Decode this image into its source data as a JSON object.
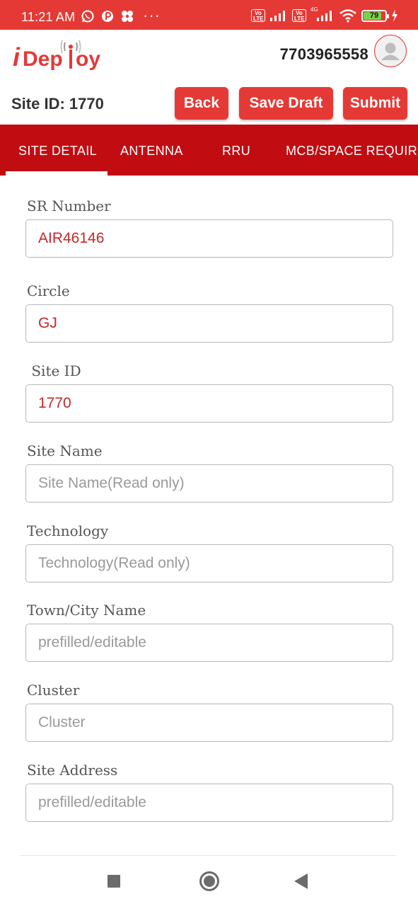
{
  "status_bar": {
    "time": "11:21 AM",
    "left_icons": [
      "whatsapp-icon",
      "pocket-icon",
      "fan-icon"
    ],
    "overflow": "···",
    "volte_1": "Vo LTE",
    "volte_2": "Vo LTE",
    "network_4g": "4G",
    "battery_level": "79",
    "colors": {
      "background": "#e53935"
    }
  },
  "header": {
    "logo_text": "iDeploy",
    "phone": "7703965558"
  },
  "actions": {
    "site_id_label": "Site ID: 1770",
    "back": "Back",
    "save_draft": "Save Draft",
    "submit": "Submit"
  },
  "tabs": [
    {
      "label": "SITE DETAIL",
      "active": true
    },
    {
      "label": "ANTENNA",
      "active": false
    },
    {
      "label": "RRU",
      "active": false
    },
    {
      "label": "MCB/SPACE REQUIR",
      "active": false
    }
  ],
  "form": {
    "sr_number": {
      "label": "SR Number",
      "value": "AIR46146"
    },
    "circle": {
      "label": "Circle",
      "value": "GJ"
    },
    "site_id": {
      "label": " Site ID",
      "value": "1770"
    },
    "site_name": {
      "label": "Site Name",
      "placeholder": "Site Name(Read only)"
    },
    "technology": {
      "label": "Technology",
      "placeholder": "Technology(Read only)"
    },
    "town_city": {
      "label": "Town/City Name",
      "placeholder": "prefilled/editable"
    },
    "cluster": {
      "label": "Cluster",
      "placeholder": "Cluster"
    },
    "site_address": {
      "label": "Site Address",
      "placeholder": "prefilled/editable"
    }
  },
  "nav": {
    "icons": [
      "recents-icon",
      "home-icon",
      "back-icon"
    ]
  },
  "theme": {
    "primary": "#e53935",
    "tab_bar": "#c10d12",
    "value_text": "#c62828"
  }
}
